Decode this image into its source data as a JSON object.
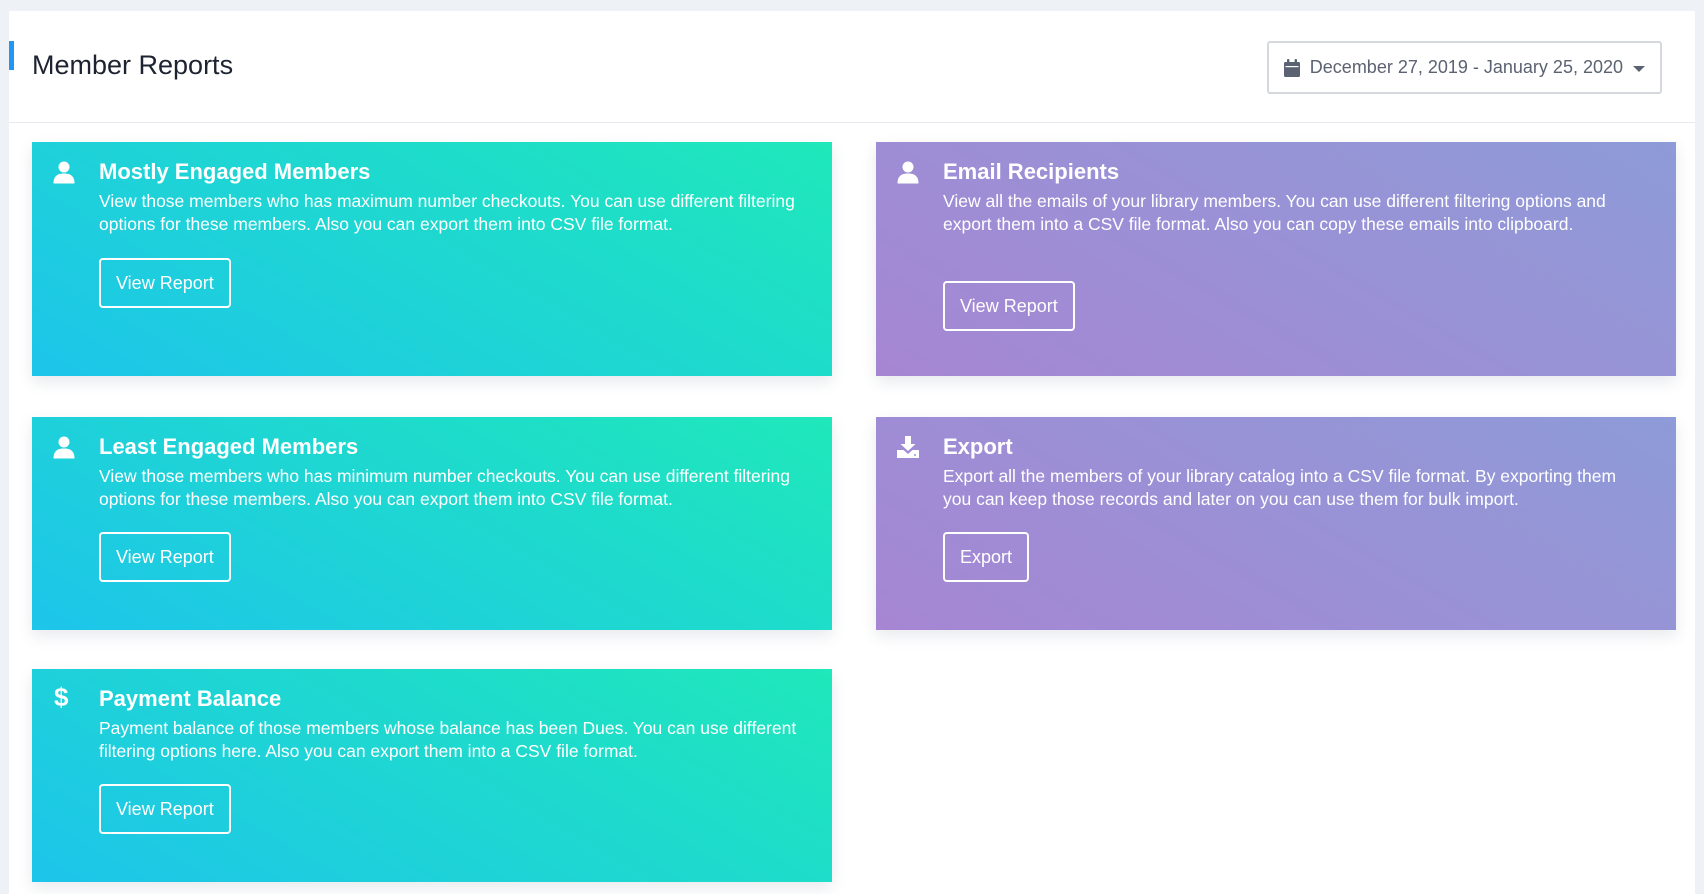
{
  "header": {
    "title": "Member Reports",
    "date_range": "December 27, 2019 - January 25, 2020",
    "date_icon": "calendar-icon",
    "dropdown_icon": "caret-down-icon"
  },
  "colors": {
    "accent": "#2196f3",
    "teal_gradient": [
      "#1dc5ea",
      "#1fe8ba"
    ],
    "purple_gradient": [
      "#a686d3",
      "#8e9bd8"
    ]
  },
  "cards": {
    "mostly_engaged": {
      "icon": "user-icon",
      "title": "Mostly Engaged Members",
      "description": "View those members who has maximum number checkouts. You can use different filtering options for these members. Also you can export them into CSV file format.",
      "button": "View Report"
    },
    "email_recipients": {
      "icon": "user-icon",
      "title": "Email Recipients",
      "description": "View all the emails of your library members. You can use different filtering options and export them into a CSV file format. Also you can copy these emails into clipboard.",
      "button": "View Report"
    },
    "least_engaged": {
      "icon": "user-icon",
      "title": "Least Engaged Members",
      "description": "View those members who has minimum number checkouts. You can use different filtering options for these members. Also you can export them into CSV file format.",
      "button": "View Report"
    },
    "export": {
      "icon": "download-icon",
      "title": "Export",
      "description": "Export all the members of your library catalog into a CSV file format. By exporting them you can keep those records and later on you can use them for bulk import.",
      "button": "Export"
    },
    "payment_balance": {
      "icon": "dollar-icon",
      "icon_glyph": "$",
      "title": "Payment Balance",
      "description": "Payment balance of those members whose balance has been Dues. You can use different filtering options here. Also you can export them into a CSV file format.",
      "button": "View Report"
    }
  }
}
